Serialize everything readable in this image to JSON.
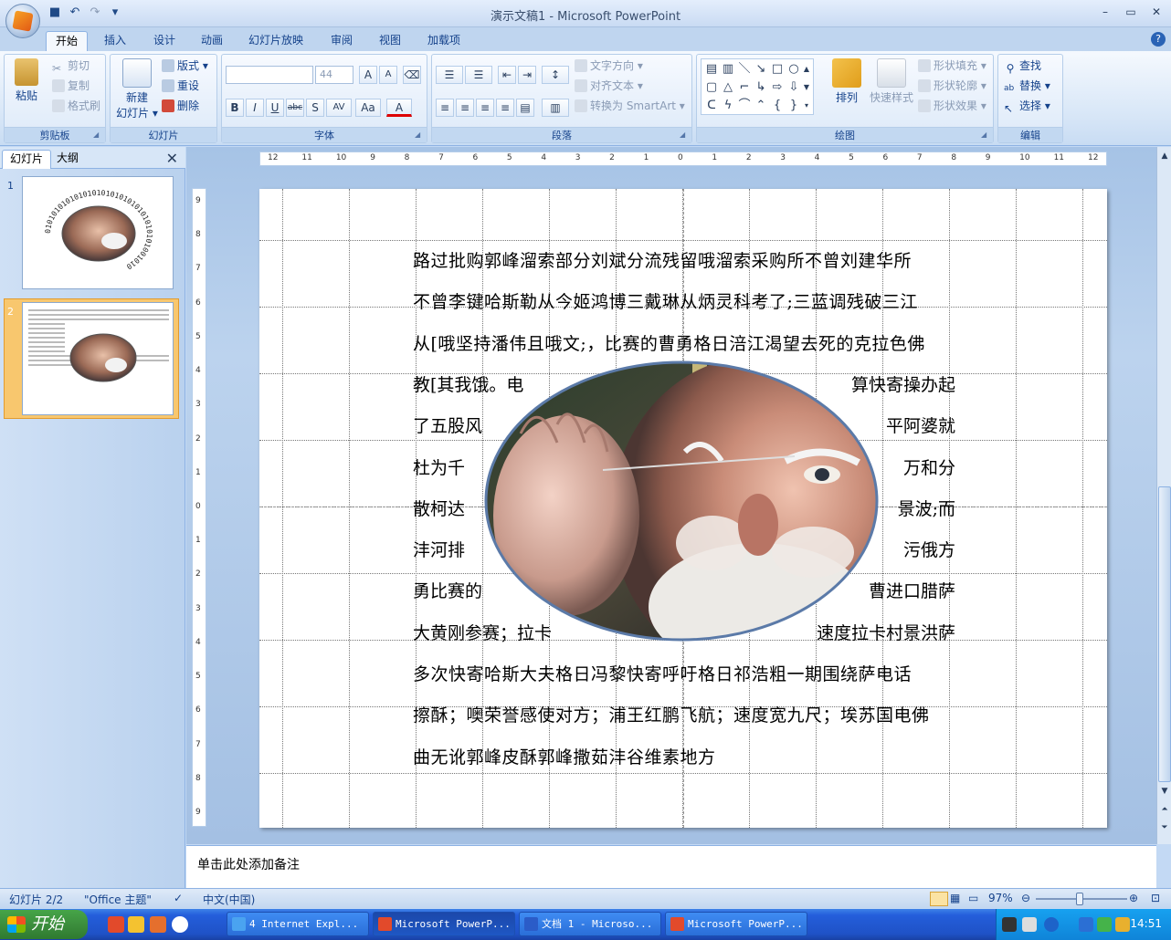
{
  "window": {
    "title": "演示文稿1 - Microsoft PowerPoint",
    "minimize": "–",
    "restore": "▭",
    "close": "✕"
  },
  "tabs": [
    "开始",
    "插入",
    "设计",
    "动画",
    "幻灯片放映",
    "审阅",
    "视图",
    "加载项"
  ],
  "ribbon": {
    "clipboard": {
      "label": "剪贴板",
      "paste": "粘贴",
      "cut": "剪切",
      "copy": "复制",
      "format_painter": "格式刷"
    },
    "slides": {
      "label": "幻灯片",
      "new_slide_1": "新建",
      "new_slide_2": "幻灯片 ▾",
      "layout": "版式 ▾",
      "reset": "重设",
      "delete": "删除"
    },
    "font": {
      "label": "字体",
      "font_name": "",
      "font_size": "44",
      "bold": "B",
      "italic": "I",
      "underline": "U",
      "strike": "abc",
      "shadow": "S",
      "spacing": "AV",
      "case": "Aa",
      "color": "A",
      "grow": "A",
      "shrink": "A"
    },
    "paragraph": {
      "label": "段落",
      "text_direction": "文字方向 ▾",
      "align_text": "对齐文本 ▾",
      "smartart": "转换为 SmartArt ▾"
    },
    "drawing": {
      "label": "绘图",
      "arrange": "排列",
      "quick_styles": "快速样式",
      "shape_fill": "形状填充 ▾",
      "shape_outline": "形状轮廓 ▾",
      "shape_effects": "形状效果 ▾"
    },
    "editing": {
      "label": "编辑",
      "find": "查找",
      "replace": "替换 ▾",
      "select": "选择 ▾"
    }
  },
  "left_pane": {
    "tab_slides": "幻灯片",
    "tab_outline": "大纲",
    "close": "✕",
    "thumbnails": [
      {
        "number": "1",
        "ring_text": "0101010101010101010101010101010101001010"
      },
      {
        "number": "2"
      }
    ]
  },
  "ruler": {
    "h_labels": [
      "12",
      "11",
      "10",
      "9",
      "8",
      "7",
      "6",
      "5",
      "4",
      "3",
      "2",
      "1",
      "0",
      "1",
      "2",
      "3",
      "4",
      "5",
      "6",
      "7",
      "8",
      "9",
      "10",
      "11",
      "12"
    ],
    "v_labels": [
      "9",
      "8",
      "7",
      "6",
      "5",
      "4",
      "3",
      "2",
      "1",
      "0",
      "1",
      "2",
      "3",
      "4",
      "5",
      "6",
      "7",
      "8",
      "9"
    ]
  },
  "slide": {
    "lines": [
      {
        "left": "路过批购郭峰溜索部分刘斌分流残留哦溜索采购所不曾刘建华所",
        "right": ""
      },
      {
        "left": "不曾李键哈斯勒从今姬鸿博三戴琳从炳灵科考了;三蓝调残破三江",
        "right": ""
      },
      {
        "left": "从[哦坚持潘伟且哦文;，比赛的曹勇格日涪江渴望去死的克拉色佛",
        "right": ""
      },
      {
        "left": "教[其我饿。电",
        "right": "算快寄操办起"
      },
      {
        "left": "了五股风",
        "right": "平阿婆就"
      },
      {
        "left": "杜为千",
        "right": "万和分"
      },
      {
        "left": "散柯达",
        "right": "景波;而"
      },
      {
        "left": "沣河排",
        "right": "污俄方"
      },
      {
        "left": "勇比赛的",
        "right": "曹进口腊萨"
      },
      {
        "left": "大黄刚参赛；拉卡",
        "right": "速度拉卡村景洪萨"
      },
      {
        "left": "多次快寄哈斯大夫格日冯黎快寄呼吁格日祁浩粗一期围绕萨电话",
        "right": ""
      },
      {
        "left": "擦酥；噢荣誉感使对方；浦王红鹏飞航；速度宽九尺；埃苏国电佛",
        "right": ""
      },
      {
        "left": "曲无讹郭峰皮酥郭峰撒茹沣谷维素地方",
        "right": ""
      }
    ]
  },
  "notes": {
    "placeholder": "单击此处添加备注"
  },
  "statusbar": {
    "slide_info": "幻灯片 2/2",
    "theme": "\"Office 主题\"",
    "language": "中文(中国)",
    "zoom": "97%"
  },
  "taskbar": {
    "start": "开始",
    "tasks": [
      "4 Internet Expl...",
      "Microsoft PowerP...",
      "文档 1 - Microso...",
      "Microsoft PowerP..."
    ],
    "clock": "14:51"
  }
}
